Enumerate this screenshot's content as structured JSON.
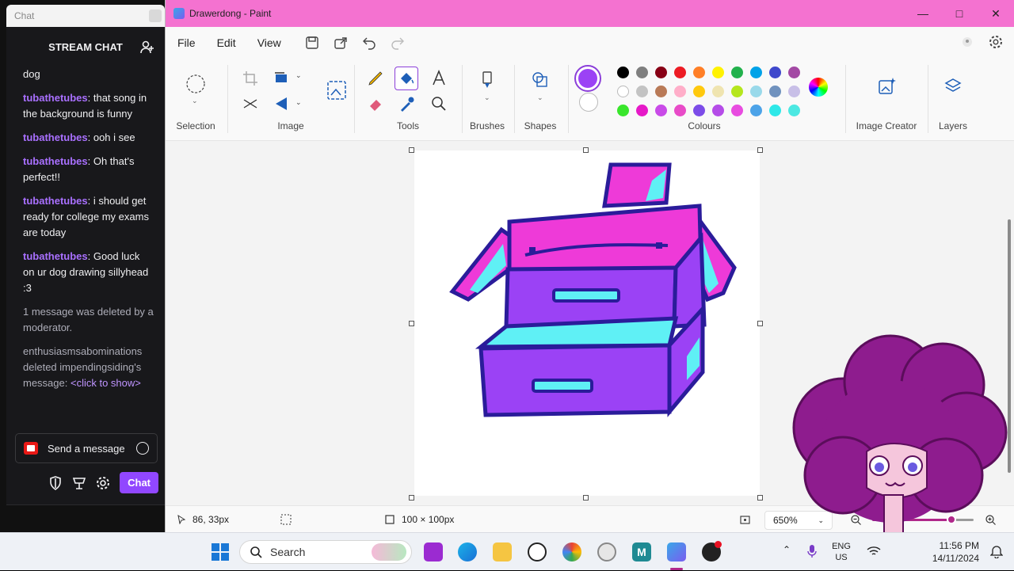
{
  "chat": {
    "tab_label": "Chat",
    "header": "STREAM CHAT",
    "messages": [
      {
        "type": "cont",
        "text": "dog"
      },
      {
        "type": "user",
        "user": "tubathetubes",
        "text": ": that song in the background is funny"
      },
      {
        "type": "user",
        "user": "tubathetubes",
        "text": ": ooh i see"
      },
      {
        "type": "user",
        "user": "tubathetubes",
        "text": ": Oh that's perfect!!"
      },
      {
        "type": "user",
        "user": "tubathetubes",
        "text": ": i should get ready for college my exams are today"
      },
      {
        "type": "user",
        "user": "tubathetubes",
        "text": ": Good luck on ur dog drawing sillyhead :3"
      },
      {
        "type": "sys",
        "text": "1 message was deleted by a moderator."
      },
      {
        "type": "sys",
        "text": "enthusiasmsabominations deleted impendingsiding's message: ",
        "link": "<click to show>"
      }
    ],
    "input_placeholder": "Send a message",
    "chat_button": "Chat"
  },
  "paint": {
    "window_title": "Drawerdong - Paint",
    "menus": [
      "File",
      "Edit",
      "View"
    ],
    "ribbon_groups": {
      "selection": "Selection",
      "image": "Image",
      "tools": "Tools",
      "brushes": "Brushes",
      "shapes": "Shapes",
      "colours": "Colours",
      "image_creator": "Image Creator",
      "layers": "Layers"
    },
    "primary_color": "#9b42f5",
    "secondary_color": "#ffffff",
    "palette_row1": [
      "#000000",
      "#7f7f7f",
      "#880015",
      "#ed1c24",
      "#ff7f27",
      "#fff200",
      "#22b14c",
      "#00a2e8",
      "#3f48cc",
      "#a349a4"
    ],
    "palette_row2": [
      "#ffffff",
      "#c3c3c3",
      "#b97a57",
      "#ffaec9",
      "#ffc90e",
      "#efe4b0",
      "#b5e61d",
      "#99d9ea",
      "#7092be",
      "#c8bfe7"
    ],
    "palette_row3": [
      "#39e62c",
      "#e619c8",
      "#c94be8",
      "#e84bc8",
      "#7c4ce8",
      "#b54ce8",
      "#e84ce0",
      "#4ca3e8",
      "#2ee8e8",
      "#4ce8e2"
    ],
    "status": {
      "cursor_pos": "86, 33px",
      "canvas_size": "100 × 100px",
      "zoom": "650%",
      "zoom_level": 0.78
    }
  },
  "taskbar": {
    "search_placeholder": "Search",
    "lang_top": "ENG",
    "lang_bottom": "US",
    "time": "11:56 PM",
    "date": "14/11/2024"
  }
}
